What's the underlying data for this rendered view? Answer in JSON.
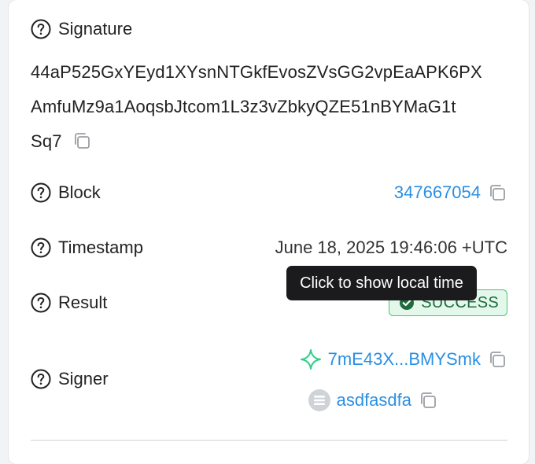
{
  "signature": {
    "label": "Signature",
    "value_lines": [
      "44aP525GxYEyd1XYsnNTGkfEvosZVsGG2vpEaAPK6PX",
      "AmfuMz9a1AoqsbJtcom1L3z3vZbkyQZE51nBYMaG1t",
      "Sq7"
    ]
  },
  "block": {
    "label": "Block",
    "value": "347667054"
  },
  "timestamp": {
    "label": "Timestamp",
    "value": "June 18, 2025 19:46:06 +UTC",
    "tooltip": "Click to show local time"
  },
  "result": {
    "label": "Result",
    "status": "SUCCESS",
    "status_color": "#1f6b3d"
  },
  "signer": {
    "label": "Signer",
    "address": "7mE43X...BMYSmk",
    "domain": "asdfasdfa"
  },
  "colors": {
    "link": "#2b8fe3",
    "success_bg": "#e3f7ea",
    "success_border": "#47c47a",
    "tooltip_bg": "#1b1b1d"
  },
  "icons": {
    "help": "question-circle-icon",
    "copy": "copy-icon",
    "success": "check-circle-icon",
    "signer_address": "sparkle-icon",
    "signer_domain": "domain-avatar-icon"
  }
}
